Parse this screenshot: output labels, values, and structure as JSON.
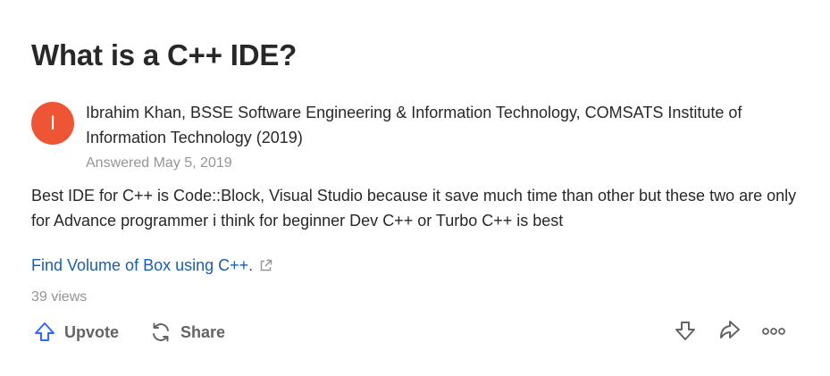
{
  "question": {
    "title": "What is a C++ IDE?"
  },
  "author": {
    "avatar_initial": "I",
    "credential": "Ibrahim Khan, BSSE Software Engineering & Information Technology, COMSATS Institute of Information Technology (2019)",
    "answered_date": "Answered May 5, 2019"
  },
  "answer": {
    "body": "Best IDE for C++ is Code::Block, Visual Studio because it save much time than other but these two are only for Advance programmer i think for beginner Dev C++ or Turbo C++ is best",
    "link_text": "Find Volume of Box using C++.",
    "views": "39 views"
  },
  "actions": {
    "upvote_label": "Upvote",
    "share_label": "Share"
  },
  "colors": {
    "avatar_bg": "#ee5535",
    "link": "#195faa",
    "upvote_icon": "#2e69ff",
    "muted_text": "#939598"
  },
  "icons": {
    "upvote": "upvote-arrow-icon",
    "share": "share-cycle-icon",
    "downvote": "downvote-arrow-icon",
    "forward": "forward-arrow-icon",
    "more": "more-dots-icon",
    "external_link": "external-link-icon"
  }
}
